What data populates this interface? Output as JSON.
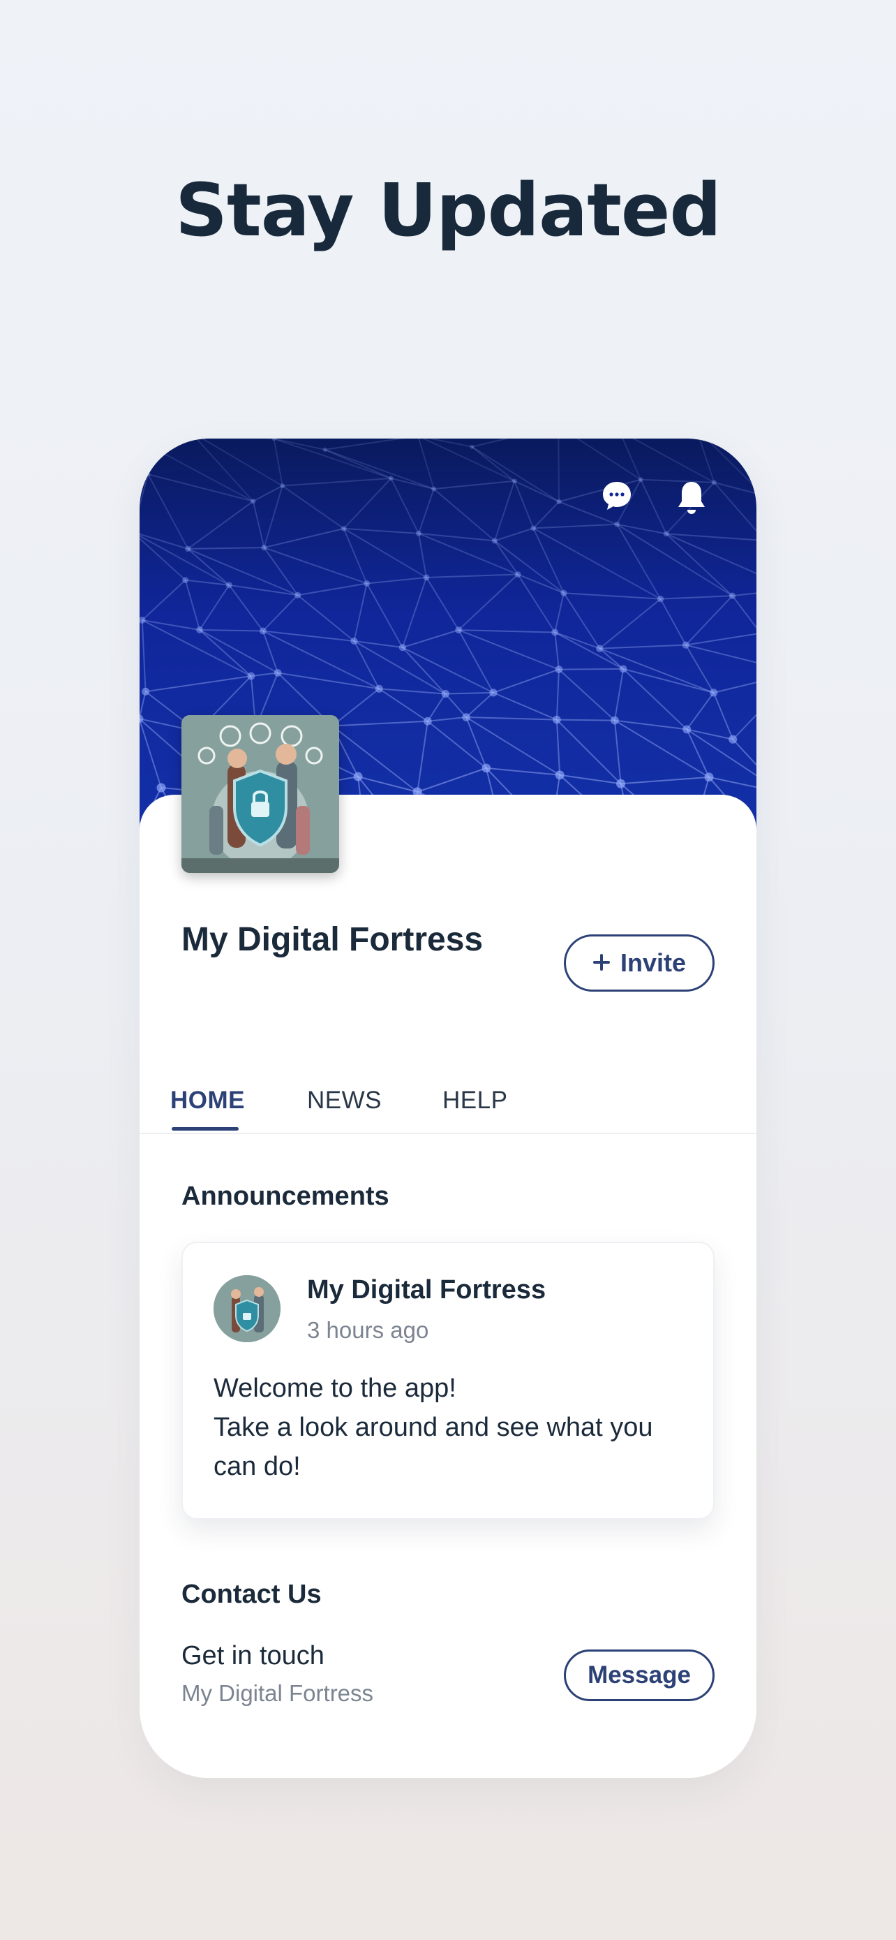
{
  "hero": {
    "title": "Stay Updated"
  },
  "header_icons": [
    {
      "name": "chat-bubble-icon"
    },
    {
      "name": "bell-icon"
    }
  ],
  "site": {
    "name": "My Digital Fortress",
    "invite_label": "Invite",
    "invite_icon": "plus-icon"
  },
  "tabs": [
    {
      "label": "HOME",
      "active": true
    },
    {
      "label": "NEWS",
      "active": false
    },
    {
      "label": "HELP",
      "active": false
    }
  ],
  "announcements": {
    "title": "Announcements",
    "post": {
      "author": "My Digital Fortress",
      "time": "3 hours ago",
      "lines": [
        "Welcome to the app!",
        "Take a look around and see what you",
        "can do!"
      ]
    }
  },
  "contact": {
    "title": "Contact Us",
    "primary": "Get in touch",
    "secondary": "My Digital Fortress",
    "button_label": "Message"
  },
  "colors": {
    "accent": "#2c4276",
    "cover_dark": "#0a1a5e",
    "cover_light": "#1330a8",
    "text_primary": "#1b2a3a",
    "text_secondary": "#7b8490"
  }
}
